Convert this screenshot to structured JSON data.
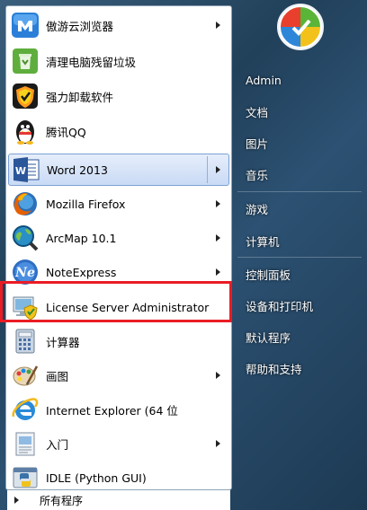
{
  "programs": [
    {
      "label": "傲游云浏览器",
      "icon": "maxthon-icon",
      "has_submenu": true
    },
    {
      "label": "清理电脑残留垃圾",
      "icon": "recycle-bin-icon",
      "has_submenu": false
    },
    {
      "label": "强力卸载软件",
      "icon": "uninstaller-shield-icon",
      "has_submenu": false
    },
    {
      "label": "腾讯QQ",
      "icon": "qq-penguin-icon",
      "has_submenu": false
    },
    {
      "label": "Word 2013",
      "icon": "word-icon",
      "has_submenu": true,
      "selected": true
    },
    {
      "label": "Mozilla Firefox",
      "icon": "firefox-icon",
      "has_submenu": true
    },
    {
      "label": "ArcMap 10.1",
      "icon": "arcmap-globe-icon",
      "has_submenu": true
    },
    {
      "label": "NoteExpress",
      "icon": "noteexpress-icon",
      "has_submenu": true
    },
    {
      "label": "License Server Administrator",
      "icon": "license-server-icon",
      "has_submenu": false,
      "highlighted": true
    },
    {
      "label": "计算器",
      "icon": "calculator-icon",
      "has_submenu": false
    },
    {
      "label": "画图",
      "icon": "paint-icon",
      "has_submenu": true
    },
    {
      "label": "Internet Explorer (64 位",
      "icon": "internet-explorer-icon",
      "has_submenu": false
    },
    {
      "label": "入门",
      "icon": "getting-started-icon",
      "has_submenu": true
    },
    {
      "label": "IDLE (Python GUI)",
      "icon": "python-idle-icon",
      "has_submenu": false
    }
  ],
  "all_programs_label": "所有程序",
  "right_items": [
    {
      "label": "Admin"
    },
    {
      "label": "文档"
    },
    {
      "label": "图片"
    },
    {
      "label": "音乐"
    },
    {
      "label": "游戏"
    },
    {
      "label": "计算机"
    },
    {
      "label": "控制面板"
    },
    {
      "label": "设备和打印机"
    },
    {
      "label": "默认程序"
    },
    {
      "label": "帮助和支持"
    }
  ],
  "colors": {
    "highlight_border": "#ea1c24",
    "selected_item_bg": "#c9daf5",
    "menu_panel_dark": "#21405a"
  }
}
